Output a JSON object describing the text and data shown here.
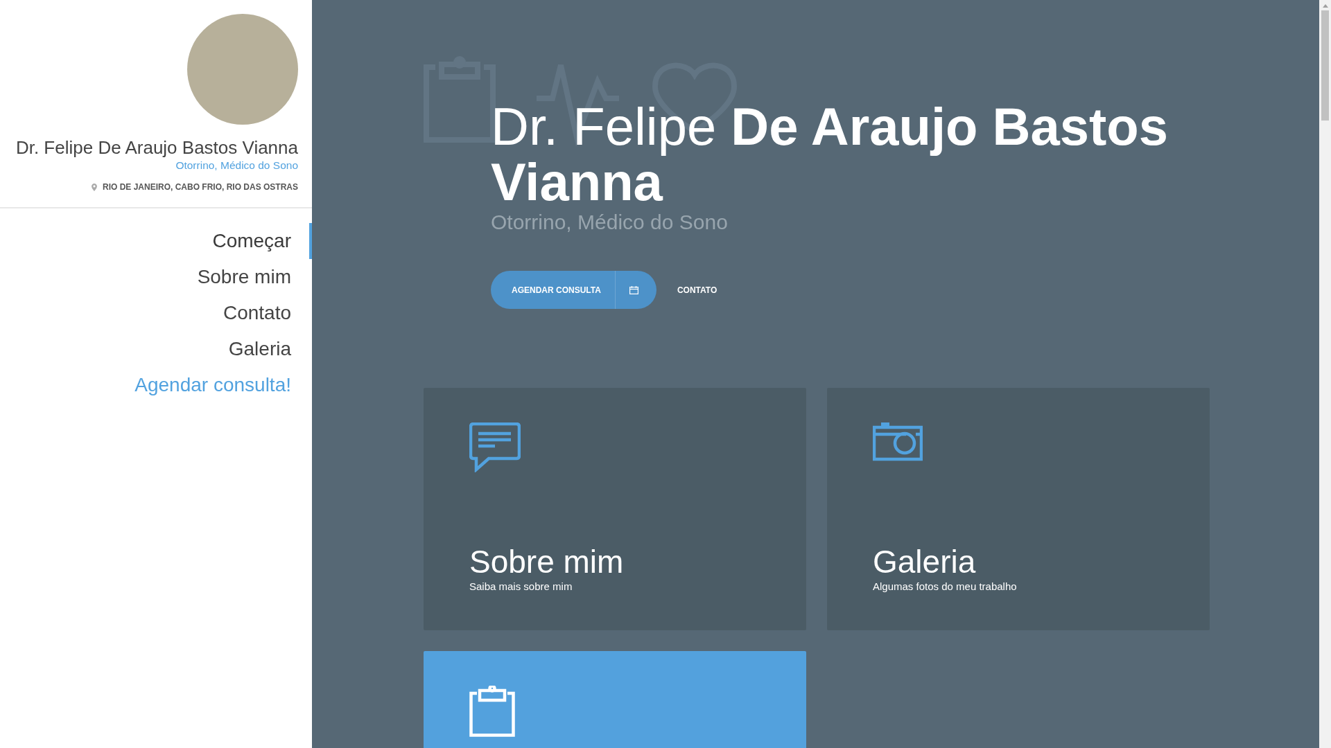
{
  "sidebar": {
    "name": "Dr. Felipe De Araujo Bastos Vianna",
    "specialty": "Otorrino, Médico do Sono",
    "location": "RIO DE JANEIRO, CABO FRIO, RIO DAS OSTRAS",
    "nav": [
      {
        "label": "Começar",
        "selected": true,
        "kind": "link"
      },
      {
        "label": "Sobre mim",
        "selected": false,
        "kind": "link"
      },
      {
        "label": "Contato",
        "selected": false,
        "kind": "link"
      },
      {
        "label": "Galeria",
        "selected": false,
        "kind": "link"
      },
      {
        "label": "Agendar consulta!",
        "selected": false,
        "kind": "cta"
      }
    ]
  },
  "hero": {
    "title": "Dr. Felipe **De Araujo Bastos Vianna**",
    "subtitle": "Otorrino, Médico do Sono",
    "buttons": [
      {
        "label": "AGENDAR CONSULTA",
        "kind": "primary"
      },
      {
        "label": "CONTATO",
        "kind": "plain"
      }
    ]
  },
  "cards": [
    {
      "title": "Sobre mim",
      "subtitle": "Saiba mais sobre mim",
      "highlighted": false
    },
    {
      "title": "Galeria",
      "subtitle": "Algumas fotos do meu trabalho",
      "highlighted": false
    },
    {
      "highlighted": true
    }
  ]
}
